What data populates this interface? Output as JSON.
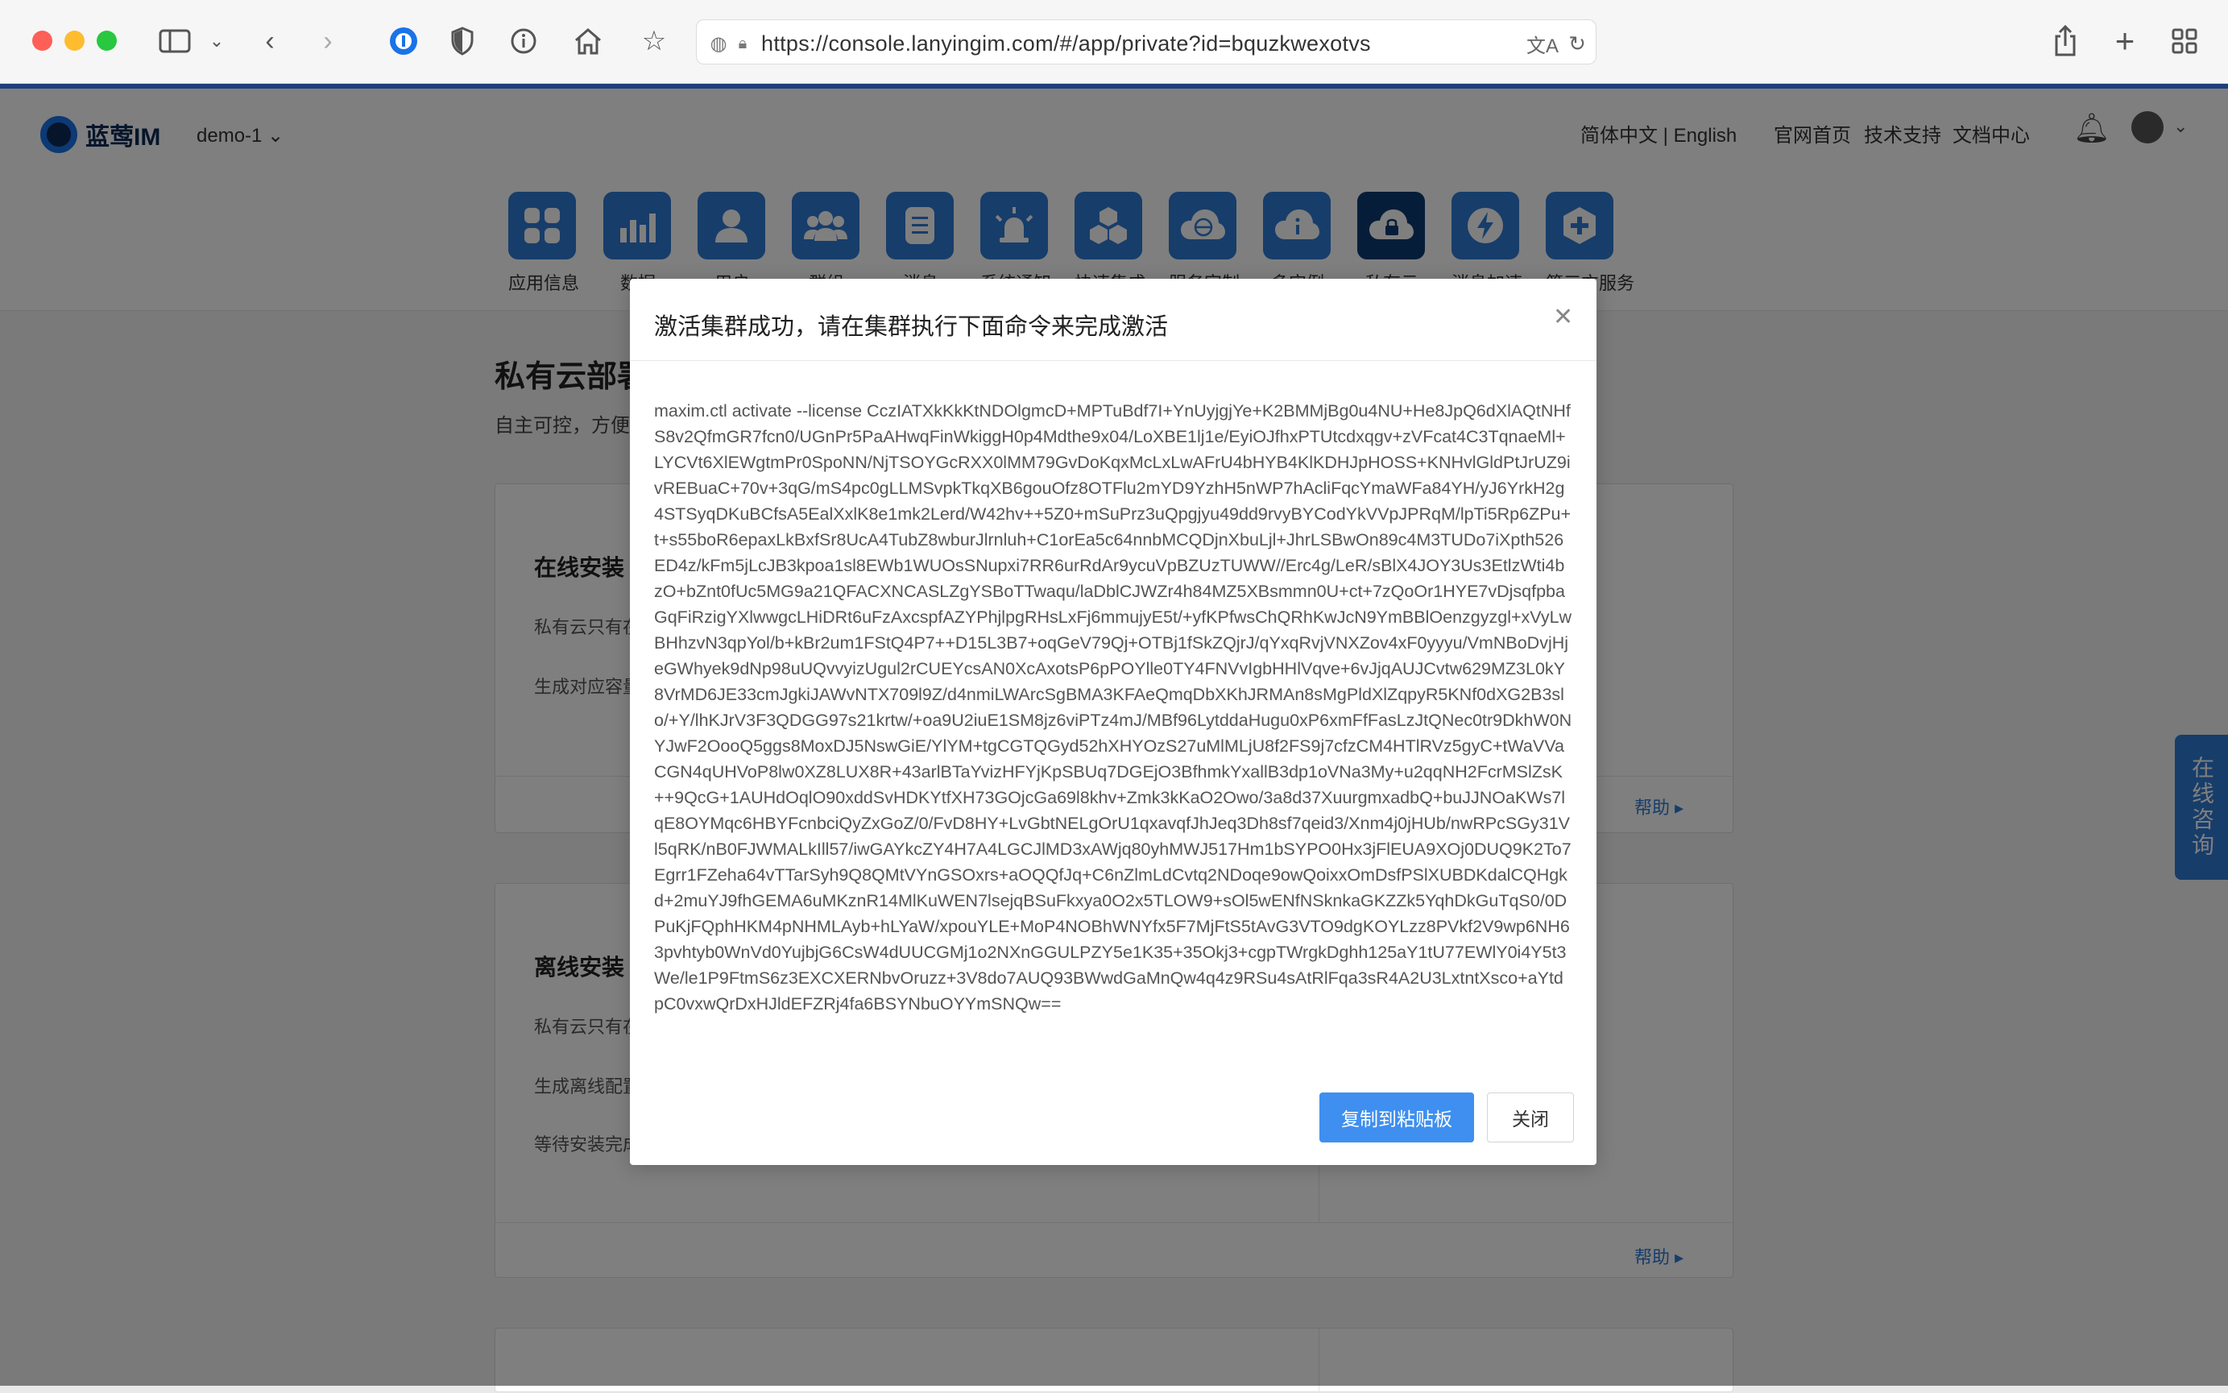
{
  "browser": {
    "url": "https://console.lanyingim.com/#/app/private?id=bquzkwexotvs"
  },
  "header": {
    "logo_text": "蓝莺IM",
    "app_selector": "demo-1 ⌄",
    "lang_switch": "简体中文 | English",
    "links": [
      "官网首页",
      "技术支持",
      "文档中心"
    ]
  },
  "nav": {
    "items": [
      {
        "label": "应用信息",
        "icon": "grid-icon"
      },
      {
        "label": "数据",
        "icon": "bar-chart-icon"
      },
      {
        "label": "用户",
        "icon": "user-icon"
      },
      {
        "label": "群组",
        "icon": "users-icon"
      },
      {
        "label": "消息",
        "icon": "document-icon"
      },
      {
        "label": "系统通知",
        "icon": "alarm-icon"
      },
      {
        "label": "快速集成",
        "icon": "cubes-icon"
      },
      {
        "label": "服务定制",
        "icon": "cloud-globe-icon"
      },
      {
        "label": "多实例",
        "icon": "cloud-info-icon"
      },
      {
        "label": "私有云",
        "icon": "cloud-lock-icon"
      },
      {
        "label": "消息加速",
        "icon": "lightning-icon"
      },
      {
        "label": "第三方服务",
        "icon": "plus-icon"
      }
    ]
  },
  "page": {
    "title": "私有云部署",
    "subtitle": "自主可控，方便",
    "online_card": {
      "title": "在线安装",
      "line1": "私有云只有在",
      "line2": "生成对应容量",
      "help": "帮助 ▸"
    },
    "offline_card": {
      "title": "离线安装",
      "line1": "私有云只有在",
      "line2": "生成离线配置",
      "line3": "等待安装完成",
      "help": "帮助 ▸"
    }
  },
  "side_consult": "在线咨询",
  "modal": {
    "title": "激活集群成功，请在集群执行下面命令来完成激活",
    "command": "maxim.ctl activate --license CczIATXkKkKtNDOlgmcD+MPTuBdf7I+YnUyjgjYe+K2BMMjBg0u4NU+He8JpQ6dXlAQtNHfS8v2QfmGR7fcn0/UGnPr5PaAHwqFinWkiggH0p4Mdthe9x04/LoXBE1lj1e/EyiOJfhxPTUtcdxqgv+zVFcat4C3TqnaeMl+LYCVt6XlEWgtmPr0SpoNN/NjTSOYGcRXX0lMM79GvDoKqxMcLxLwAFrU4bHYB4KlKDHJpHOSS+KNHvlGldPtJrUZ9ivREBuaC+70v+3qG/mS4pc0gLLMSvpkTkqXB6gouOfz8OTFlu2mYD9YzhH5nWP7hAcliFqcYmaWFa84YH/yJ6YrkH2g4STSyqDKuBCfsA5EalXxlK8e1mk2Lerd/W42hv++5Z0+mSuPrz3uQpgjyu49dd9rvyBYCodYkVVpJPRqM/lpTi5Rp6ZPu+t+s55boR6epaxLkBxfSr8UcA4TubZ8wburJlrnluh+C1orEa5c64nnbMCQDjnXbuLjl+JhrLSBwOn89c4M3TUDo7iXpth526ED4z/kFm5jLcJB3kpoa1sl8EWb1WUOsSNupxi7RR6urRdAr9ycuVpBZUzTUWW//Erc4g/LeR/sBlX4JOY3Us3EtlzWti4bzO+bZnt0fUc5MG9a21QFACXNCASLZgYSBoTTwaqu/laDblCJWZr4h84MZ5XBsmmn0U+ct+7zQoOr1HYE7vDjsqfpbaGqFiRzigYXlwwgcLHiDRt6uFzAxcspfAZYPhjlpgRHsLxFj6mmujyE5t/+yfKPfwsChQRhKwJcN9YmBBlOenzgyzgl+xVyLwBHhzvN3qpYol/b+kBr2um1FStQ4P7++D15L3B7+oqGeV79Qj+OTBj1fSkZQjrJ/qYxqRvjVNXZov4xF0yyyu/VmNBoDvjHjeGWhyek9dNp98uUQvvyizUgul2rCUEYcsAN0XcAxotsP6pPOYlle0TY4FNVvIgbHHlVqve+6vJjqAUJCvtw629MZ3L0kY8VrMD6JE33cmJgkiJAWvNTX709l9Z/d4nmiLWArcSgBMA3KFAeQmqDbXKhJRMAn8sMgPldXlZqpyR5KNf0dXG2B3slo/+Y/lhKJrV3F3QDGG97s21krtw/+oa9U2iuE1SM8jz6viPTz4mJ/MBf96LytddaHugu0xP6xmFfFasLzJtQNec0tr9DkhW0NYJwF2OooQ5ggs8MoxDJ5NswGiE/YlYM+tgCGTQGyd52hXHYOzS27uMlMLjU8f2FS9j7cfzCM4HTlRVz5gyC+tWaVVaCGN4qUHVoP8lw0XZ8LUX8R+43arlBTaYvizHFYjKpSBUq7DGEjO3BfhmkYxallB3dp1oVNa3My+u2qqNH2FcrMSlZsK++9QcG+1AUHdOqlO90xddSvHDKYtfXH73GOjcGa69l8khv+Zmk3kKaO2Owo/3a8d37XuurgmxadbQ+buJJNOaKWs7lqE8OYMqc6HBYFcnbciQyZxGoZ/0/FvD8HY+LvGbtNELgOrU1qxavqfJhJeq3Dh8sf7qeid3/Xnm4j0jHUb/nwRPcSGy31Vl5qRK/nB0FJWMALkIll57/iwGAYkcZY4H7A4LGCJlMD3xAWjq80yhMWJ517Hm1bSYPO0Hx3jFlEUA9XOj0DUQ9K2To7Egrr1FZeha64vTTarSyh9Q8QMtVYnGSOxrs+aOQQfJq+C6nZlmLdCvtq2NDoqe9owQoixxOmDsfPSlXUBDKdalCQHgkd+2muYJ9fhGEMA6uMKznR14MlKuWEN7lsejqBSuFkxya0O2x5TLOW9+sOl5wENfNSknkaGKZZk5YqhDkGuTqS0/0DPuKjFQphHKM4pNHMLAyb+hLYaW/xpouYLE+MoP4NOBhWNYfx5F7MjFtS5tAvG3VTO9dgKOYLzz8PVkf2V9wp6NH63pvhtyb0WnVd0YujbjG6CsW4dUUCGMj1o2NXnGGULPZY5e1K35+35Okj3+cgpTWrgkDghh125aY1tU77EWlY0i4Y5t3We/le1P9FtmS6z3EXCXERNbvOruzz+3V8do7AUQ93BWwdGaMnQw4q4z9RSu4sAtRlFqa3sR4A2U3LxtntXsco+aYtdpC0vxwQrDxHJldEFZRj4fa6BSYNbuOYYmSNQw==",
    "copy_button": "复制到粘贴板",
    "close_button": "关闭"
  }
}
